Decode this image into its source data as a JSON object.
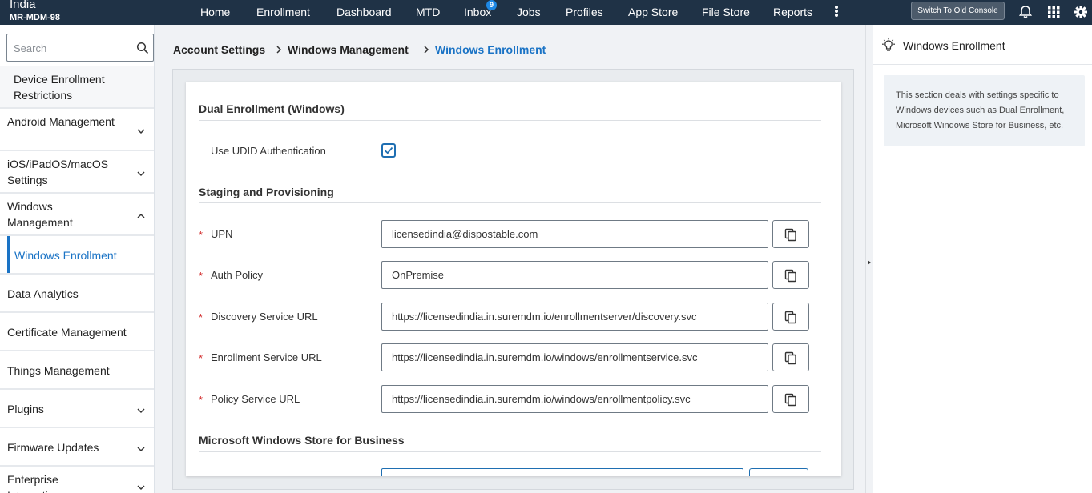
{
  "topbar": {
    "org_name": "India",
    "org_id": "MR-MDM-98",
    "nav": [
      "Home",
      "Enrollment",
      "Dashboard",
      "MTD",
      "Inbox",
      "Jobs",
      "Profiles",
      "App Store",
      "File Store",
      "Reports"
    ],
    "inbox_badge": "9",
    "switch_console": "Switch To Old Console"
  },
  "sidebar": {
    "search_placeholder": "Search",
    "items": [
      {
        "label": "Device Enrollment Restrictions"
      },
      {
        "label": "Android Management"
      },
      {
        "label": "iOS/iPadOS/macOS Settings"
      },
      {
        "label": "Windows Management"
      },
      {
        "label": "Windows Enrollment"
      },
      {
        "label": "Data Analytics"
      },
      {
        "label": "Certificate Management"
      },
      {
        "label": "Things Management"
      },
      {
        "label": "Plugins"
      },
      {
        "label": "Firmware Updates"
      },
      {
        "label": "Enterprise Integrations"
      }
    ]
  },
  "breadcrumb": [
    "Account Settings",
    "Windows Management",
    "Windows Enrollment"
  ],
  "content": {
    "dual_title": "Dual Enrollment (Windows)",
    "udid_label": "Use UDID Authentication",
    "udid_checked": true,
    "staging_title": "Staging and Provisioning",
    "fields": [
      {
        "label": "UPN",
        "value": "licensedindia@dispostable.com"
      },
      {
        "label": "Auth Policy",
        "value": "OnPremise"
      },
      {
        "label": "Discovery Service URL",
        "value": "https://licensedindia.in.suremdm.io/enrollmentserver/discovery.svc"
      },
      {
        "label": "Enrollment Service URL",
        "value": "https://licensedindia.in.suremdm.io/windows/enrollmentservice.svc"
      },
      {
        "label": "Policy Service URL",
        "value": "https://licensedindia.in.suremdm.io/windows/enrollmentpolicy.svc"
      }
    ],
    "store_title": "Microsoft Windows Store for Business"
  },
  "help": {
    "title": "Windows Enrollment",
    "text": "This section deals with settings specific to Windows devices such as Dual Enrollment, Microsoft Windows Store for Business, etc."
  },
  "colors": {
    "topbar": "#1f3246",
    "accent": "#1a73c5",
    "required": "#d32f2f"
  }
}
